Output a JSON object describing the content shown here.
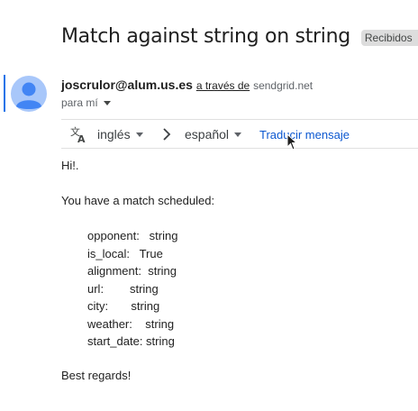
{
  "email": {
    "subject": "Match against string on string",
    "label_chip": "Recibidos",
    "label_chip_close": "×",
    "sender_email": "joscrulor@alum.us.es",
    "via_text": "a través de",
    "via_domain": "sendgrid.net",
    "to_text": "para mí"
  },
  "translate_bar": {
    "source_lang": "inglés",
    "target_lang": "español",
    "translate_link": "Traducir mensaje"
  },
  "body": {
    "greeting": "Hi!.",
    "intro": "You have a match scheduled:",
    "details": [
      "opponent:   string",
      "is_local:   True",
      "alignment:  string",
      "url:        string",
      "city:       string",
      "weather:    string",
      "start_date: string"
    ],
    "closing": "Best regards!"
  },
  "colors": {
    "accent": "#1a73e8",
    "link": "#0b57d0",
    "avatar_bg": "#a8c7fa",
    "avatar_fg": "#4285f4"
  },
  "icons": [
    "person-avatar-icon",
    "translate-icon",
    "chevron-right-icon",
    "caret-down-icon",
    "mouse-cursor-icon"
  ]
}
